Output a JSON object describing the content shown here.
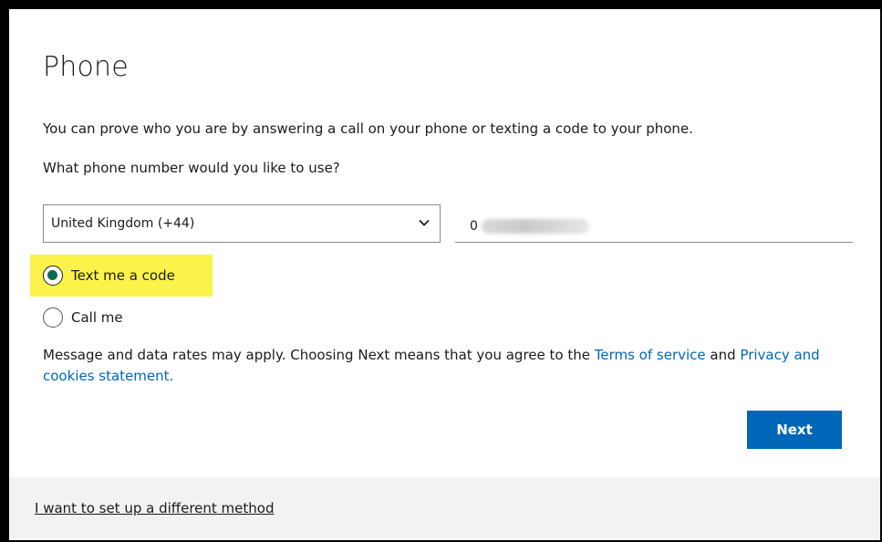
{
  "page": {
    "title": "Phone",
    "description": "You can prove who you are by answering a call on your phone or texting a code to your phone.",
    "question": "What phone number would you like to use?"
  },
  "country_select": {
    "selected": "United Kingdom (+44)"
  },
  "phone_input": {
    "visible_prefix": "0",
    "value_obscured": true
  },
  "methods": [
    {
      "label": "Text me a code",
      "checked": true,
      "highlighted": true
    },
    {
      "label": "Call me",
      "checked": false,
      "highlighted": false
    }
  ],
  "terms": {
    "text": "Message and data rates may apply. Choosing Next means that you agree to the ",
    "terms_link": "Terms of service",
    "and": " and ",
    "privacy_link": "Privacy and cookies statement."
  },
  "buttons": {
    "next_label": "Next"
  },
  "footer": {
    "link": "I want to set up a different method"
  },
  "colors": {
    "accent": "#0067b8",
    "highlight": "#fcf34a",
    "radio_checked": "#0a6b4d",
    "footer_bg": "#f2f2f2"
  },
  "icons": {
    "dropdown": "chevron-down-icon",
    "radio_selected": "radio-checked-icon",
    "radio_unselected": "radio-unchecked-icon"
  }
}
